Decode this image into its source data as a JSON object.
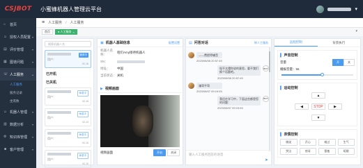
{
  "header": {
    "logo": "CSJBOT",
    "title": "小蜜蜂机器人管理云平台",
    "user_icon": "user-icon",
    "more_icon": "chevron-down-icon"
  },
  "sidebar": {
    "items": [
      {
        "icon": "home-icon",
        "label": "首页"
      },
      {
        "icon": "robot-icon",
        "label": "授权人员配置",
        "caret": "▾"
      },
      {
        "icon": "chart-icon",
        "label": "评价管理",
        "caret": "▾"
      },
      {
        "icon": "file-icon",
        "label": "图谱问题",
        "caret": "▾"
      },
      {
        "icon": "service-icon",
        "label": "人工服务",
        "caret": "▴"
      },
      {
        "icon": "robot-icon",
        "label": "机器人管理",
        "caret": "▾"
      },
      {
        "icon": "bar-icon",
        "label": "数据分析",
        "caret": "▾"
      },
      {
        "icon": "gear-icon",
        "label": "知识库管理",
        "caret": "▾"
      },
      {
        "icon": "users-icon",
        "label": "客户管理",
        "caret": "▾"
      }
    ],
    "subitems": [
      "人工服务",
      "服务记录",
      "坐席数"
    ]
  },
  "breadcrumb": {
    "menu_icon": "≡",
    "root": "人工服务",
    "sep": "/",
    "leaf": "人工服务"
  },
  "tabs": [
    {
      "label": "首页"
    },
    {
      "label": "● 人工服务",
      "close": "×"
    }
  ],
  "robot_list": {
    "search_placeholder": "搜索机器人名",
    "selected": {
      "user": "用户：",
      "status": "服务中",
      "time": "02-16"
    },
    "group_online": "已开机",
    "group_offline": "已关机",
    "offline_cards": [
      {
        "user": "用户：",
        "status": "休息中",
        "time": "02-16"
      },
      {
        "user": "用户：",
        "status": "休息中",
        "time": "02-13"
      },
      {
        "user": "用户：",
        "status": "休息中",
        "time": "02-10"
      },
      {
        "user": "用户：",
        "status": "休息中",
        "time": "02-10"
      }
    ]
  },
  "info": {
    "title": "机器人基础信息",
    "edit_link": "配置设置",
    "rows": [
      {
        "key": "机器人名称：",
        "val": "咱们Amy接待机器人"
      },
      {
        "key": "SN：",
        "val": ""
      },
      {
        "key": "地址：",
        "val": "中国"
      },
      {
        "key": "当前状态：",
        "val": "关机"
      }
    ],
    "video_title": "视频画面",
    "video_label": "视频画面",
    "video_btn_on": "开启",
    "video_btn_off": "关闭"
  },
  "chat": {
    "title": "问答对话",
    "head_link": "转人工服务",
    "messages": [
      {
        "side": "left",
        "text": "——费提得辅音",
        "time": "2023/08/08 20:57:49"
      },
      {
        "side": "right",
        "text": "现不太懂你说的意思，要不我们换个话题吧。",
        "time": "2023/08/08 20:57:49"
      },
      {
        "side": "left",
        "text": "谦哥平哥",
        "time": "2023/08/07 09:19:53"
      },
      {
        "side": "right",
        "text": "我还在学习中，下面这些都是您的问题：",
        "time": "2023/08/07 09:19:53"
      }
    ],
    "bot_label": "BOT",
    "input_placeholder": "输入人工服务回答的语音",
    "send_icon": "send-icon"
  },
  "control": {
    "tab_active": "远程控制",
    "tab_other": "背景执行",
    "voice_title": "声音控制",
    "voice_row": "音量",
    "seg_on": "开",
    "seg_off": "关",
    "volume_label": "播报音量：56",
    "volume_value": 0.56,
    "motion_title": "运动控制",
    "up": "▲",
    "down": "▼",
    "left": "◀",
    "right": "▶",
    "stop": "STOP",
    "expr_title": "表情控制",
    "expressions": [
      "微笑",
      "开心",
      "难过",
      "生气",
      "哭泣",
      "惊讶",
      "害羞",
      "眨眼"
    ]
  }
}
